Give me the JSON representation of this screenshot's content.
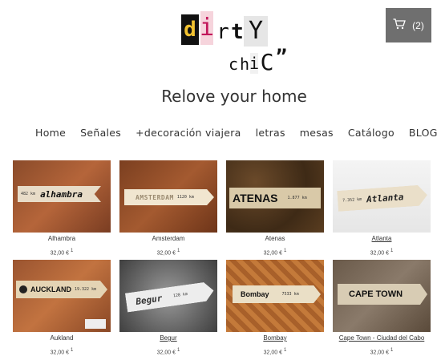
{
  "brand": {
    "logo_letters": [
      "d",
      "i",
      "r",
      "t",
      "Y",
      "c",
      "h",
      "i",
      "C",
      "”"
    ]
  },
  "cart": {
    "count": "(2)",
    "icon": "cart-icon"
  },
  "tagline": "Relove your home",
  "nav": [
    "Home",
    "Señales",
    "+decoración viajera",
    "letras",
    "mesas",
    "Catálogo",
    "BLOG"
  ],
  "products": [
    {
      "name": "Alhambra",
      "price": "32,00 €",
      "note": "1",
      "sign_text": "alhambra",
      "sign_km": "482 km"
    },
    {
      "name": "Amsterdam",
      "price": "32,00 €",
      "note": "1",
      "sign_text": "AMSTERDAM",
      "sign_km": "1120 km"
    },
    {
      "name": "Atenas",
      "price": "32,00 €",
      "note": "1",
      "sign_text": "ATENAS",
      "sign_km": "1.877 km"
    },
    {
      "name": "Atlanta",
      "price": "32,00 €",
      "note": "1",
      "sign_text": "Atlanta",
      "sign_km": "7.352 km"
    },
    {
      "name": "Aukland",
      "price": "32,00 €",
      "note": "1",
      "sign_text": "AUCKLAND",
      "sign_km": "19.322 km"
    },
    {
      "name": "Begur",
      "price": "32,00 €",
      "note": "1",
      "sign_text": "Begur",
      "sign_km": "128 km"
    },
    {
      "name": "Bombay",
      "price": "32,00 €",
      "note": "1",
      "sign_text": "Bombay",
      "sign_km": "7533 km"
    },
    {
      "name": "Cape Town - Ciudad del Cabo",
      "price": "32,00 €",
      "note": "1",
      "sign_text": "CAPE TOWN",
      "sign_km": ""
    }
  ],
  "colors": {
    "cart_bg": "#6f6f6f",
    "accent_pink": "#c2185b",
    "logo_yellow": "#f2c230"
  }
}
